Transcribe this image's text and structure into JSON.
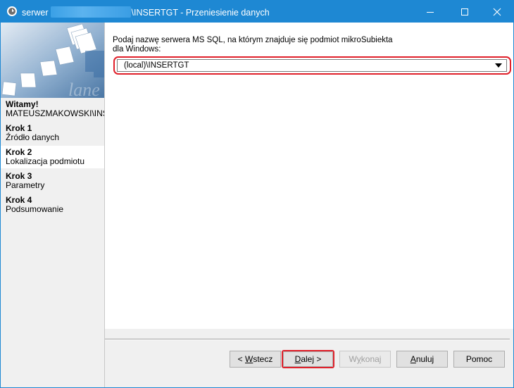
{
  "window": {
    "title_prefix": "serwer",
    "title_suffix": "\\INSERTGT - Przeniesienie danych",
    "accent": "#1e88d3"
  },
  "sidebar": {
    "steps": [
      {
        "heading": "Witamy!",
        "sub": "MATEUSZMAKOWSKI\\INSE"
      },
      {
        "heading": "Krok 1",
        "sub": "Źródło danych"
      },
      {
        "heading": "Krok 2",
        "sub": "Lokalizacja podmiotu"
      },
      {
        "heading": "Krok 3",
        "sub": "Parametry"
      },
      {
        "heading": "Krok 4",
        "sub": "Podsumowanie"
      }
    ],
    "active_step": "Krok 2"
  },
  "main": {
    "prompt_line1": "Podaj nazwę serwera MS SQL, na którym znajduje się podmiot mikroSubiekta",
    "prompt_line2": "dla Windows:",
    "server_value": "(local)\\INSERTGT",
    "highlight_color": "#e0202a"
  },
  "buttons": {
    "back": {
      "prefix": "< ",
      "mnemonic": "W",
      "rest": "stecz"
    },
    "next": {
      "mnemonic": "D",
      "rest": "alej >"
    },
    "finish": {
      "prefix": "W",
      "mnemonic": "y",
      "rest": "konaj"
    },
    "cancel": {
      "mnemonic": "A",
      "rest": "nuluj"
    },
    "help": "Pomoc"
  }
}
